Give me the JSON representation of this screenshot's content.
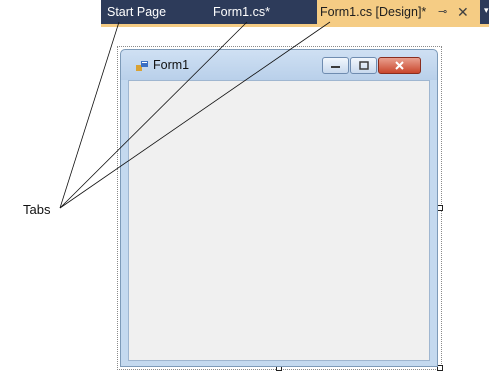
{
  "tabs": [
    {
      "label": "Start Page"
    },
    {
      "label": "Form1.cs*"
    },
    {
      "label": "Form1.cs [Design]*",
      "active": true
    }
  ],
  "tab_controls": {
    "pin": "⊸",
    "close": "✕",
    "overflow": "▾"
  },
  "form": {
    "title": "Form1"
  },
  "callout": {
    "label": "Tabs"
  },
  "colors": {
    "tabstrip": "#2d3b5a",
    "active_tab": "#f5cc84",
    "form_client": "#f0f0f0",
    "form_frame": "#c4d9ef"
  },
  "icons": [
    "pin-icon",
    "close-icon",
    "overflow-icon",
    "form-app-icon",
    "minimize-icon",
    "maximize-icon",
    "close-window-icon"
  ]
}
